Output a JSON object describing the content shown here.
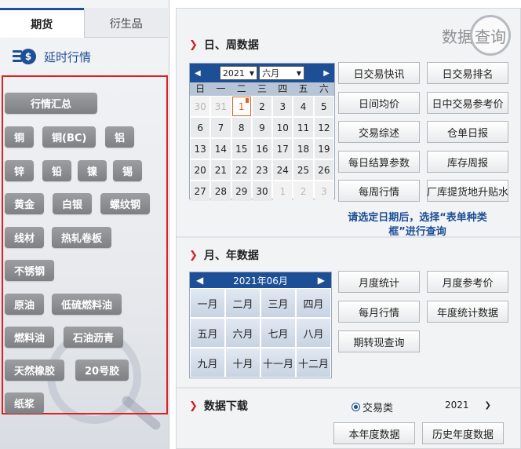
{
  "tabs": {
    "futures": "期货",
    "derivatives": "衍生品"
  },
  "delay": {
    "icon": "dollar-coin-icon",
    "label": "延时行情"
  },
  "market": {
    "summary": "行情汇总",
    "items": [
      "铜",
      "铜(BC)",
      "铝",
      "锌",
      "铅",
      "镍",
      "锡",
      "黄金",
      "白银",
      "螺纹钢",
      "线材",
      "热轧卷板",
      "不锈钢",
      "原油",
      "低硫燃料油",
      "燃料油",
      "石油沥青",
      "天然橡胶",
      "20号胶",
      "纸浆"
    ]
  },
  "header": {
    "title_a": "数据",
    "title_b": "查询"
  },
  "sections": {
    "daily": "日、周数据",
    "monthly": "月、年数据",
    "download": "数据下载"
  },
  "calendar": {
    "year": "2021",
    "month": "六月",
    "weekdays": [
      "日",
      "一",
      "二",
      "三",
      "四",
      "五",
      "六"
    ],
    "days": [
      "30",
      "31",
      "1",
      "2",
      "3",
      "4",
      "5",
      "6",
      "7",
      "8",
      "9",
      "10",
      "11",
      "12",
      "13",
      "14",
      "15",
      "16",
      "17",
      "18",
      "19",
      "20",
      "21",
      "22",
      "23",
      "24",
      "25",
      "26",
      "27",
      "28",
      "29",
      "30",
      "1",
      "2",
      "3"
    ],
    "muted_indices": [
      0,
      1,
      32,
      33,
      34
    ],
    "today_index": 2
  },
  "daily_buttons": [
    "日交易快讯",
    "日交易排名",
    "日间均价",
    "日中交易参考价",
    "交易综述",
    "仓单日报",
    "每日结算参数",
    "库存周报",
    "每周行情",
    "厂库提货地升贴水"
  ],
  "hint": "请选定日期后，选择“表单种类框”进行查询",
  "month_panel": {
    "title": "2021年06月",
    "months": [
      "一月",
      "二月",
      "三月",
      "四月",
      "五月",
      "六月",
      "七月",
      "八月",
      "九月",
      "十月",
      "十一月",
      "十二月"
    ]
  },
  "monthly_buttons": [
    "月度统计",
    "月度参考价",
    "每月行情",
    "年度统计数据",
    "期转现查询"
  ],
  "download": {
    "radio_label": "交易类",
    "year": "2021",
    "buttons": [
      "本年度数据",
      "历史年度数据"
    ]
  },
  "colors": {
    "accent": "#1d4f96",
    "highlight_border": "#e0201e",
    "arrow": "#d21f1f"
  }
}
